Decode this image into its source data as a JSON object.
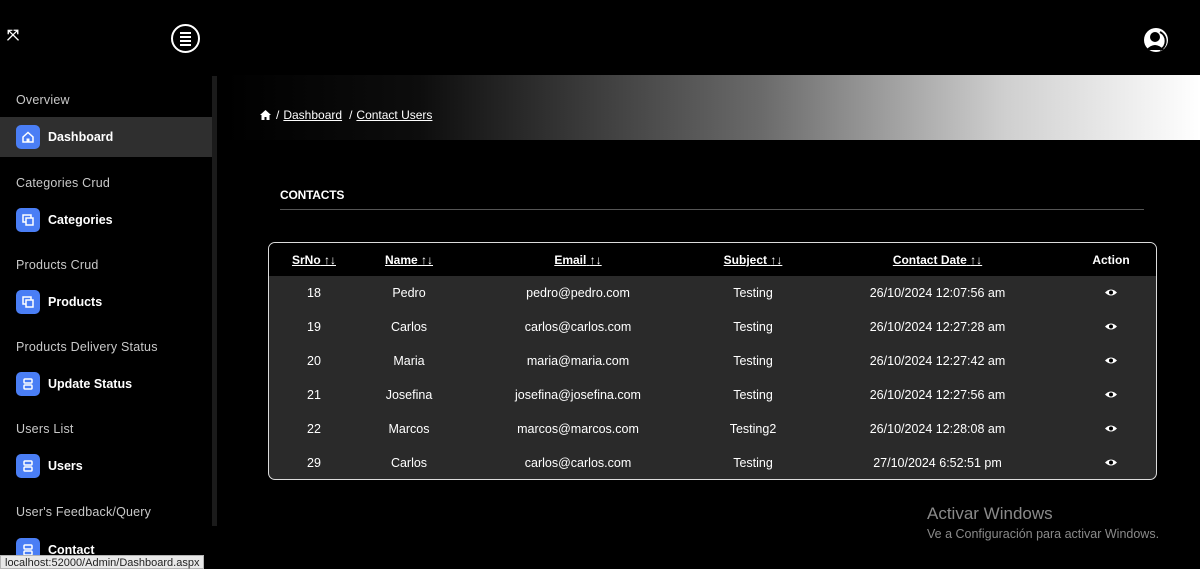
{
  "sidebar": {
    "sections": [
      {
        "title": "Overview",
        "item": "Dashboard",
        "icon": "home-icon"
      },
      {
        "title": "Categories Crud",
        "item": "Categories",
        "icon": "copy-icon"
      },
      {
        "title": "Products Crud",
        "item": "Products",
        "icon": "copy-icon"
      },
      {
        "title": "Products Delivery Status",
        "item": "Update Status",
        "icon": "server-icon"
      },
      {
        "title": "Users List",
        "item": "Users",
        "icon": "server-icon"
      },
      {
        "title": "User's Feedback/Query",
        "item": "Contact",
        "icon": "server-icon"
      }
    ]
  },
  "breadcrumb": {
    "items": [
      "Dashboard",
      "Contact Users"
    ]
  },
  "contacts": {
    "title": "CONTACTS",
    "headers": [
      "SrNo",
      "Name",
      "Email",
      "Subject",
      "Contact Date",
      "Action"
    ],
    "sort_glyph": "↑↓",
    "rows": [
      {
        "srno": "18",
        "name": "Pedro",
        "email": "pedro@pedro.com",
        "subject": "Testing",
        "date": "26/10/2024 12:07:56 am"
      },
      {
        "srno": "19",
        "name": "Carlos",
        "email": "carlos@carlos.com",
        "subject": "Testing",
        "date": "26/10/2024 12:27:28 am"
      },
      {
        "srno": "20",
        "name": "Maria",
        "email": "maria@maria.com",
        "subject": "Testing",
        "date": "26/10/2024 12:27:42 am"
      },
      {
        "srno": "21",
        "name": "Josefina",
        "email": "josefina@josefina.com",
        "subject": "Testing",
        "date": "26/10/2024 12:27:56 am"
      },
      {
        "srno": "22",
        "name": "Marcos",
        "email": "marcos@marcos.com",
        "subject": "Testing2",
        "date": "26/10/2024 12:28:08 am"
      },
      {
        "srno": "29",
        "name": "Carlos",
        "email": "carlos@carlos.com",
        "subject": "Testing",
        "date": "27/10/2024 6:52:51 pm"
      }
    ]
  },
  "status_bar": {
    "url": "localhost:52000/Admin/Dashboard.aspx"
  },
  "watermark": {
    "line1": "Activar Windows",
    "line2": "Ve a Configuración para activar Windows."
  },
  "colors": {
    "accent": "#4a7ef5",
    "background": "#000000",
    "active_item": "#2f2f2f",
    "table_body": "#2a2a2a"
  }
}
